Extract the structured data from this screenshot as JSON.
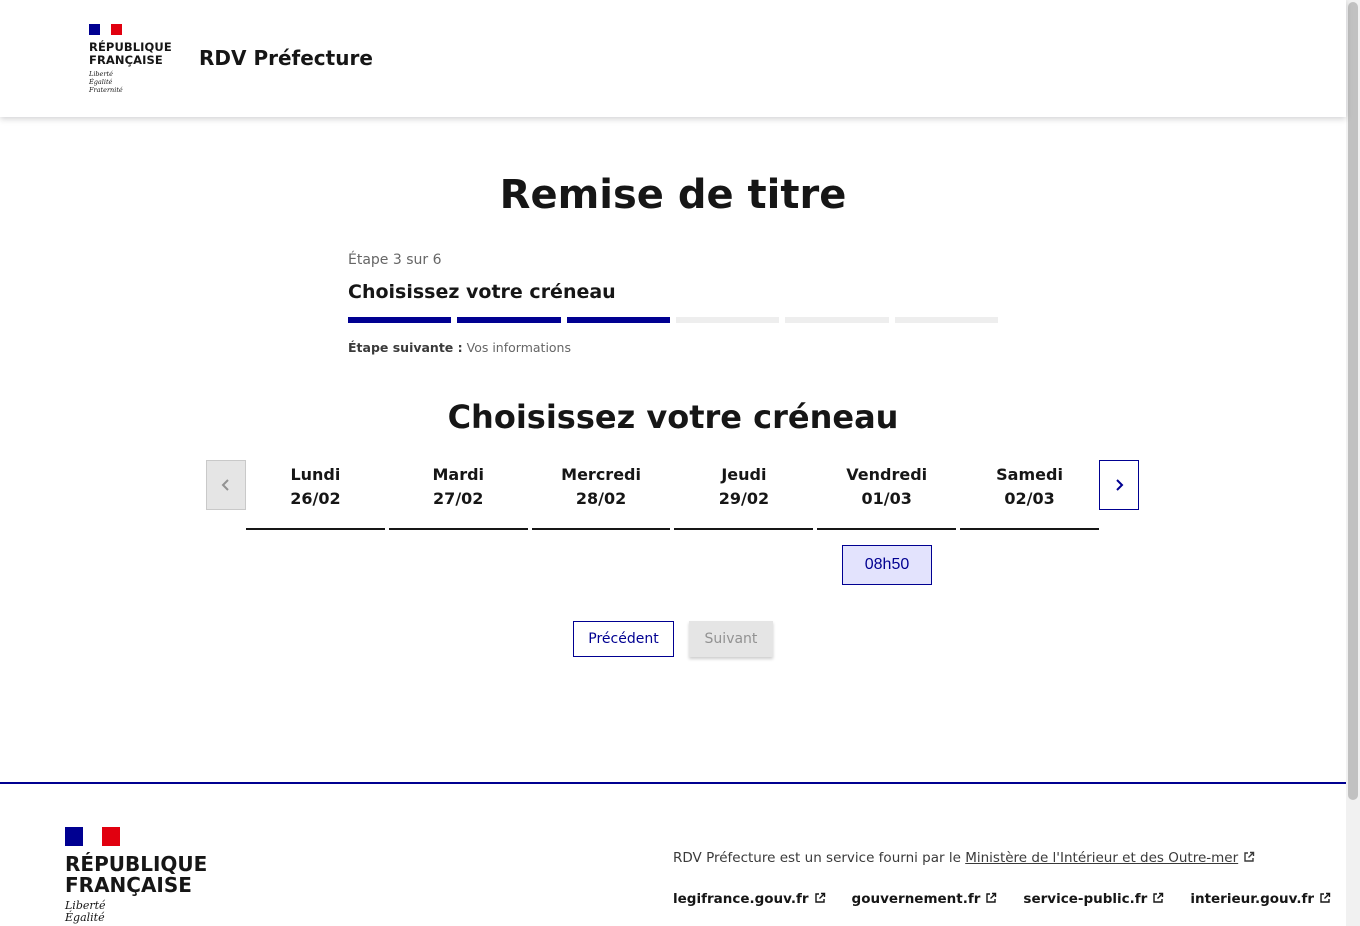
{
  "header": {
    "logo_text": "RÉPUBLIQUE FRANÇAISE",
    "motto": [
      "Liberté",
      "Égalité",
      "Fraternité"
    ],
    "site_name": "RDV Préfecture"
  },
  "main": {
    "page_title": "Remise de titre",
    "stepper": {
      "state": "Étape 3 sur 6",
      "title": "Choisissez votre créneau",
      "current_step": 3,
      "total_steps": 6,
      "next_label": "Étape suivante :",
      "next_value": "Vos informations"
    },
    "section_title": "Choisissez votre créneau",
    "calendar": {
      "days": [
        {
          "name": "Lundi",
          "date": "26/02"
        },
        {
          "name": "Mardi",
          "date": "27/02"
        },
        {
          "name": "Mercredi",
          "date": "28/02"
        },
        {
          "name": "Jeudi",
          "date": "29/02"
        },
        {
          "name": "Vendredi",
          "date": "01/03"
        },
        {
          "name": "Samedi",
          "date": "02/03"
        }
      ],
      "slots": [
        {
          "day": "Vendredi",
          "time": "08h50"
        }
      ]
    },
    "buttons": {
      "previous": "Précédent",
      "next": "Suivant"
    }
  },
  "footer": {
    "logo_text": "RÉPUBLIQUE FRANÇAISE",
    "motto": [
      "Liberté",
      "Égalité"
    ],
    "description": "RDV Préfecture est un service fourni par le ",
    "ministry_link": "Ministère de l'Intérieur et des Outre-mer",
    "links": [
      "legifrance.gouv.fr",
      "gouvernement.fr",
      "service-public.fr",
      "interieur.gouv.fr"
    ]
  },
  "colors": {
    "primary": "#000091",
    "slot_bg": "#e3e3fd",
    "flag_red": "#e1000f",
    "disabled_bg": "#e5e5e5"
  }
}
